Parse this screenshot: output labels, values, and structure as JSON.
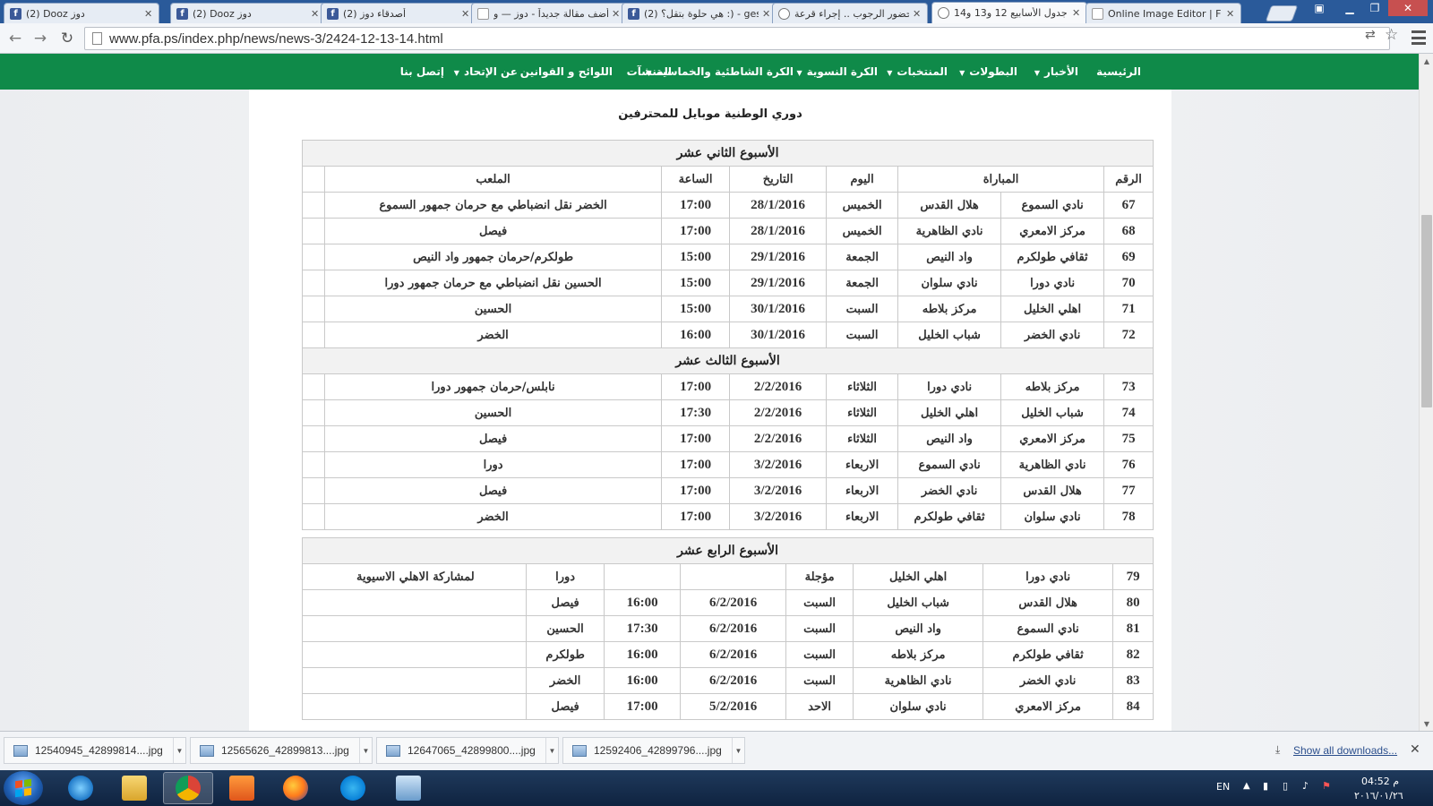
{
  "browser": {
    "tabs": [
      {
        "title": "(2) Dooz دوز",
        "icon": "facebook-icon",
        "active": false
      },
      {
        "title": "(2) Dooz دوز",
        "icon": "facebook-icon",
        "active": false
      },
      {
        "title": "(2) أصدقاء دوز",
        "icon": "facebook-icon",
        "active": false
      },
      {
        "title": "أضف مقالة جديداً - دوز — و",
        "icon": "page-icon",
        "active": false
      },
      {
        "title": "(2) هي حلوة بتقل؟ :) - ges",
        "icon": "facebook-icon",
        "active": false
      },
      {
        "title": "بحضور الرجوب .. إجراء قرعة",
        "icon": "eye-icon",
        "active": false
      },
      {
        "title": "جدول الأسابيع 12 و13 و14",
        "icon": "eye-icon",
        "active": true
      },
      {
        "title": "Online Image Editor | F",
        "icon": "page-icon",
        "active": false
      }
    ],
    "url": "www.pfa.ps/index.php/news/news-3/2424-12-13-14.html"
  },
  "site_nav": {
    "items": [
      {
        "label": "الرئيسية",
        "dropdown": false
      },
      {
        "label": "الأخبار",
        "dropdown": true
      },
      {
        "label": "البطولات",
        "dropdown": true
      },
      {
        "label": "المنتخبات",
        "dropdown": true
      },
      {
        "label": "الكرة النسوية",
        "dropdown": true
      },
      {
        "label": "الكرة الشاطئية والخماسية",
        "dropdown": true
      },
      {
        "label": "المنشآت",
        "dropdown": false
      },
      {
        "label": "اللوائح و القوانين",
        "dropdown": false
      },
      {
        "label": "عن الإتحاد",
        "dropdown": true
      },
      {
        "label": "إتصل بنا",
        "dropdown": false
      }
    ],
    "caret": "▼"
  },
  "article": {
    "league_title": "دوري الوطنية موبايل للمحترفين",
    "table1": {
      "headers": {
        "num": "الرقم",
        "match": "المباراة",
        "day": "اليوم",
        "date": "التاريخ",
        "time": "الساعة",
        "venue": "الملعب"
      },
      "weeks": [
        {
          "title": "الأسبوع الثاني عشر",
          "rows": [
            {
              "num": "67",
              "home": "نادي السموع",
              "away": "هلال القدس",
              "day": "الخميس",
              "date": "28/1/2016",
              "time": "17:00",
              "venue": "الخضر نقل انضباطي مع حرمان جمهور السموع"
            },
            {
              "num": "68",
              "home": "مركز الامعري",
              "away": "نادي الظاهرية",
              "day": "الخميس",
              "date": "28/1/2016",
              "time": "17:00",
              "venue": "فيصل"
            },
            {
              "num": "69",
              "home": "ثقافي طولكرم",
              "away": "واد النيص",
              "day": "الجمعة",
              "date": "29/1/2016",
              "time": "15:00",
              "venue": "طولكرم/حرمان جمهور واد النيص"
            },
            {
              "num": "70",
              "home": "نادي دورا",
              "away": "نادي سلوان",
              "day": "الجمعة",
              "date": "29/1/2016",
              "time": "15:00",
              "venue": "الحسين نقل انضباطي مع حرمان جمهور دورا"
            },
            {
              "num": "71",
              "home": "اهلي الخليل",
              "away": "مركز بلاطه",
              "day": "السبت",
              "date": "30/1/2016",
              "time": "15:00",
              "venue": "الحسين"
            },
            {
              "num": "72",
              "home": "نادي الخضر",
              "away": "شباب الخليل",
              "day": "السبت",
              "date": "30/1/2016",
              "time": "16:00",
              "venue": "الخضر"
            }
          ]
        },
        {
          "title": "الأسبوع الثالث عشر",
          "rows": [
            {
              "num": "73",
              "home": "مركز بلاطه",
              "away": "نادي دورا",
              "day": "الثلاثاء",
              "date": "2/2/2016",
              "time": "17:00",
              "venue": "نابلس/حرمان جمهور دورا"
            },
            {
              "num": "74",
              "home": "شباب الخليل",
              "away": "اهلي الخليل",
              "day": "الثلاثاء",
              "date": "2/2/2016",
              "time": "17:30",
              "venue": "الحسين"
            },
            {
              "num": "75",
              "home": "مركز الامعري",
              "away": "واد النيص",
              "day": "الثلاثاء",
              "date": "2/2/2016",
              "time": "17:00",
              "venue": "فيصل"
            },
            {
              "num": "76",
              "home": "نادي الظاهرية",
              "away": "نادي السموع",
              "day": "الاربعاء",
              "date": "3/2/2016",
              "time": "17:00",
              "venue": "دورا"
            },
            {
              "num": "77",
              "home": "هلال القدس",
              "away": "نادي الخضر",
              "day": "الاربعاء",
              "date": "3/2/2016",
              "time": "17:00",
              "venue": "فيصل"
            },
            {
              "num": "78",
              "home": "نادي سلوان",
              "away": "ثقافي طولكرم",
              "day": "الاربعاء",
              "date": "3/2/2016",
              "time": "17:00",
              "venue": "الخضر"
            }
          ]
        }
      ]
    },
    "table2": {
      "title": "الأسبوع الرابع عشر",
      "rows": [
        {
          "num": "79",
          "home": "نادي دورا",
          "away": "اهلي الخليل",
          "day": "مؤجلة",
          "date": "",
          "time": "",
          "venue": "دورا",
          "note": "لمشاركة الاهلي الاسيوية"
        },
        {
          "num": "80",
          "home": "هلال القدس",
          "away": "شباب الخليل",
          "day": "السبت",
          "date": "6/2/2016",
          "time": "16:00",
          "venue": "فيصل",
          "note": ""
        },
        {
          "num": "81",
          "home": "نادي السموع",
          "away": "واد النيص",
          "day": "السبت",
          "date": "6/2/2016",
          "time": "17:30",
          "venue": "الحسين",
          "note": ""
        },
        {
          "num": "82",
          "home": "ثقافي طولكرم",
          "away": "مركز بلاطه",
          "day": "السبت",
          "date": "6/2/2016",
          "time": "16:00",
          "venue": "طولكرم",
          "note": ""
        },
        {
          "num": "83",
          "home": "نادي الخضر",
          "away": "نادي الظاهرية",
          "day": "السبت",
          "date": "6/2/2016",
          "time": "16:00",
          "venue": "الخضر",
          "note": ""
        },
        {
          "num": "84",
          "home": "مركز الامعري",
          "away": "نادي سلوان",
          "day": "الاحد",
          "date": "5/2/2016",
          "time": "17:00",
          "venue": "فيصل",
          "note": ""
        }
      ]
    }
  },
  "downloads": {
    "items": [
      {
        "filename": "12540945_42899814....jpg"
      },
      {
        "filename": "12565626_42899813....jpg"
      },
      {
        "filename": "12647065_42899800....jpg"
      },
      {
        "filename": "12592406_42899796....jpg"
      }
    ],
    "show_all_label": "Show all downloads..."
  },
  "taskbar": {
    "apps": [
      {
        "name": "internet-explorer-icon",
        "active": false
      },
      {
        "name": "file-explorer-icon",
        "active": false
      },
      {
        "name": "chrome-icon",
        "active": true
      },
      {
        "name": "media-player-icon",
        "active": false
      },
      {
        "name": "firefox-icon",
        "active": false
      },
      {
        "name": "skype-icon",
        "active": false
      },
      {
        "name": "image-viewer-icon",
        "active": false
      }
    ],
    "language": "EN",
    "time": "04:52 م",
    "date": "٢٠١٦/٠١/٢٦"
  }
}
